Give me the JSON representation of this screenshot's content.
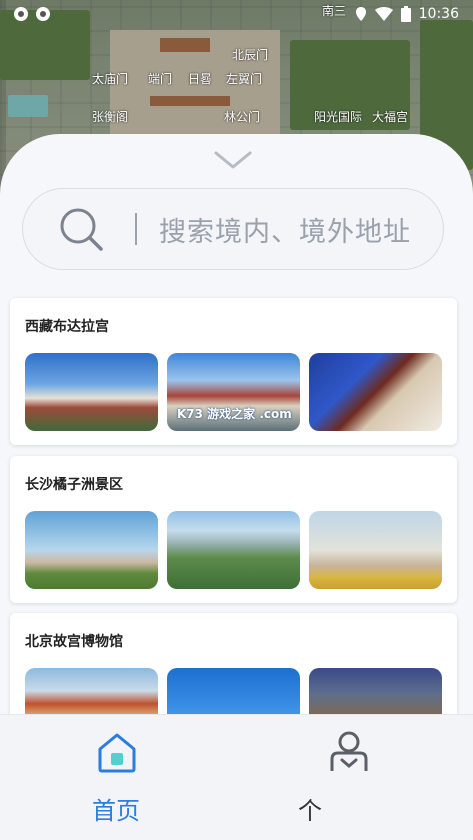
{
  "status_bar": {
    "time": "10:36"
  },
  "map": {
    "labels": [
      "南三",
      "北辰门",
      "太庙门",
      "端门",
      "日晷",
      "左翼门",
      "张衡阁",
      "林公门",
      "阳光国际",
      "大福宫"
    ]
  },
  "search": {
    "placeholder": "搜索境内、境外地址"
  },
  "cards": [
    {
      "title": "西藏布达拉宫",
      "watermark": "K73 游戏之家 .com"
    },
    {
      "title": "长沙橘子洲景区"
    },
    {
      "title": "北京故宫博物馆"
    }
  ],
  "nav": [
    {
      "label": "首页",
      "color": "#2b7de0"
    },
    {
      "label": "个",
      "color": "#333333"
    }
  ]
}
